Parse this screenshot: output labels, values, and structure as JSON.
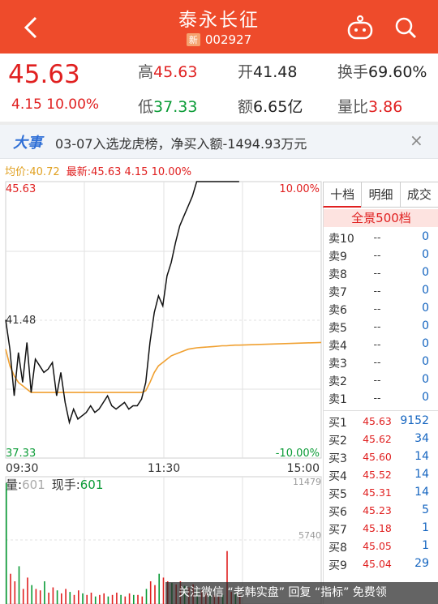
{
  "header": {
    "title": "泰永长征",
    "new_badge": "新",
    "code": "002927"
  },
  "quote": {
    "price": "45.63",
    "change": "4.15",
    "change_pct": "10.00%",
    "high_label": "高",
    "high": "45.63",
    "low_label": "低",
    "low": "37.33",
    "open_label": "开",
    "open": "41.48",
    "amount_label": "额",
    "amount": "6.65亿",
    "turnover_label": "换手",
    "turnover": "69.60%",
    "vol_ratio_label": "量比",
    "vol_ratio": "3.86"
  },
  "news": {
    "tag": "大事",
    "text": "03-07入选龙虎榜，净买入额-1494.93万元",
    "close": "×"
  },
  "legend": {
    "avg_label": "均价:",
    "avg": "40.72",
    "latest_label": "最新:",
    "latest": "45.63",
    "chg": "4.15",
    "chg_pct": "10.00%"
  },
  "chart_labels": {
    "top_price": "45.63",
    "top_pct": "10.00%",
    "mid_price": "41.48",
    "bot_price": "37.33",
    "bot_pct": "-10.00%",
    "t_open": "09:30",
    "t_mid": "11:30",
    "t_close": "15:00",
    "vol_label": "量:",
    "vol_value": "601",
    "now_label": "现手:",
    "now_value": "601",
    "vol_max": "11479",
    "vol_mid": "5740"
  },
  "chart_data": {
    "type": "line",
    "x_range": [
      "09:30",
      "15:00"
    ],
    "ylim": [
      37.33,
      45.63
    ],
    "series": [
      {
        "values": [
          41.48,
          40.6,
          39.2,
          40.5,
          39.6,
          40.8,
          39.3,
          40.3,
          40.1,
          39.9,
          40.0,
          40.2,
          39.2,
          39.9,
          39.0,
          38.4,
          38.8,
          38.5,
          38.6,
          38.7,
          38.9,
          38.7,
          38.8,
          39.0,
          39.2,
          38.9,
          38.8,
          38.9,
          39.0,
          38.8,
          38.9,
          38.9,
          39.1,
          39.6,
          40.8,
          41.7,
          42.2,
          41.9,
          42.8,
          43.2,
          43.8,
          44.3,
          44.6,
          44.9,
          45.2,
          45.63,
          45.63,
          45.63,
          45.63,
          45.63,
          45.63,
          45.63,
          45.63,
          45.63,
          45.63,
          45.63
        ]
      },
      {
        "values": [
          40.6,
          40.1,
          39.8,
          39.6,
          39.5,
          39.4,
          39.3,
          39.3,
          39.3,
          39.3,
          39.3,
          39.3,
          39.3,
          39.3,
          39.3,
          39.3,
          39.3,
          39.3,
          39.3,
          39.3,
          39.3,
          39.3,
          39.3,
          39.3,
          39.3,
          39.3,
          39.3,
          39.3,
          39.3,
          39.3,
          39.3,
          39.3,
          39.3,
          39.35,
          39.6,
          39.9,
          40.1,
          40.2,
          40.3,
          40.4,
          40.45,
          40.5,
          40.55,
          40.6,
          40.62,
          40.64,
          40.65,
          40.66,
          40.67,
          40.68,
          40.69,
          40.7,
          40.7,
          40.71,
          40.72,
          40.72
        ]
      }
    ],
    "volume_ylim": [
      0,
      11479
    ]
  },
  "right_panel": {
    "tabs": [
      "十档",
      "明细",
      "成交"
    ],
    "full_label": "全景500档",
    "sells": [
      {
        "label": "卖10",
        "price": "--",
        "vol": "0"
      },
      {
        "label": "卖9",
        "price": "--",
        "vol": "0"
      },
      {
        "label": "卖8",
        "price": "--",
        "vol": "0"
      },
      {
        "label": "卖7",
        "price": "--",
        "vol": "0"
      },
      {
        "label": "卖6",
        "price": "--",
        "vol": "0"
      },
      {
        "label": "卖5",
        "price": "--",
        "vol": "0"
      },
      {
        "label": "卖4",
        "price": "--",
        "vol": "0"
      },
      {
        "label": "卖3",
        "price": "--",
        "vol": "0"
      },
      {
        "label": "卖2",
        "price": "--",
        "vol": "0"
      },
      {
        "label": "卖1",
        "price": "--",
        "vol": "0"
      }
    ],
    "buys": [
      {
        "label": "买1",
        "price": "45.63",
        "vol": "9152"
      },
      {
        "label": "买2",
        "price": "45.62",
        "vol": "34"
      },
      {
        "label": "买3",
        "price": "45.60",
        "vol": "14"
      },
      {
        "label": "买4",
        "price": "45.52",
        "vol": "14"
      },
      {
        "label": "买5",
        "price": "45.31",
        "vol": "14"
      },
      {
        "label": "买6",
        "price": "45.23",
        "vol": "5"
      },
      {
        "label": "买7",
        "price": "45.18",
        "vol": "1"
      },
      {
        "label": "买8",
        "price": "45.05",
        "vol": "1"
      },
      {
        "label": "买9",
        "price": "45.04",
        "vol": "29"
      }
    ]
  },
  "watermark": "关注微信 “老韩实盘” 回复 “指标” 免费领",
  "colors": {
    "header": "#ee4b2b",
    "up": "#e02020",
    "down": "#0a9b36",
    "avg_line": "#f0a030"
  }
}
